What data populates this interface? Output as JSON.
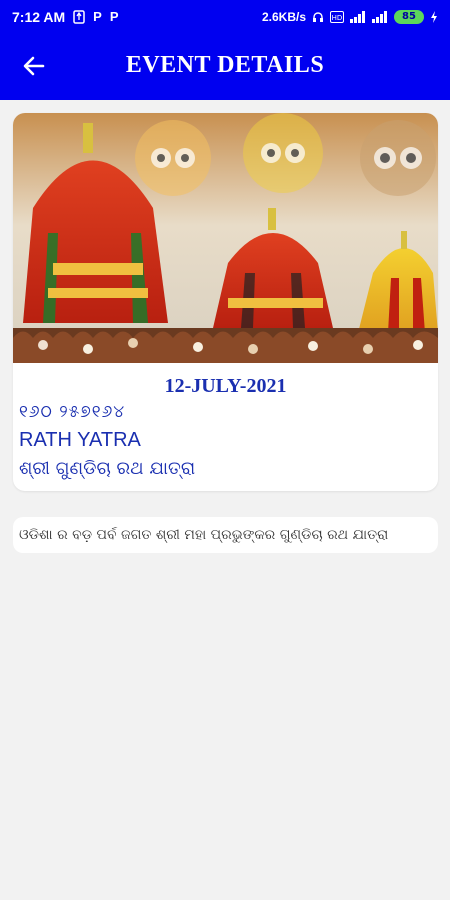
{
  "status_bar": {
    "time": "7:12 AM",
    "speed": "2.6KB/s",
    "battery": "85",
    "icons": [
      "usb-icon",
      "p-app-icon",
      "p-app-icon",
      "headset-icon",
      "hd-icon",
      "signal-icon",
      "signal-icon",
      "charging-icon"
    ]
  },
  "app_bar": {
    "title": "EVENT DETAILS",
    "back_icon": "arrow-left-icon",
    "color": "#0000f0"
  },
  "event": {
    "date": "12-JULY-2021",
    "odia_date": "୧୬ଠ ୨୫୭୧୬୪",
    "name": "RATH YATRA",
    "odia_name": "ଶ୍ରୀ ଗୁଣ୍ଡିଚା ରଥ ଯାତ୍ରା",
    "text_color": "#1a2fb0"
  },
  "description": "ଓଡିଶା ର ବଡ଼ ପର୍ବ ଜଗତ ଶ୍ରୀ ମହା ପ୍ରଭୁଙ୍କର  ଗୁଣ୍ଡିଚା ରଥ ଯାତ୍ରା"
}
